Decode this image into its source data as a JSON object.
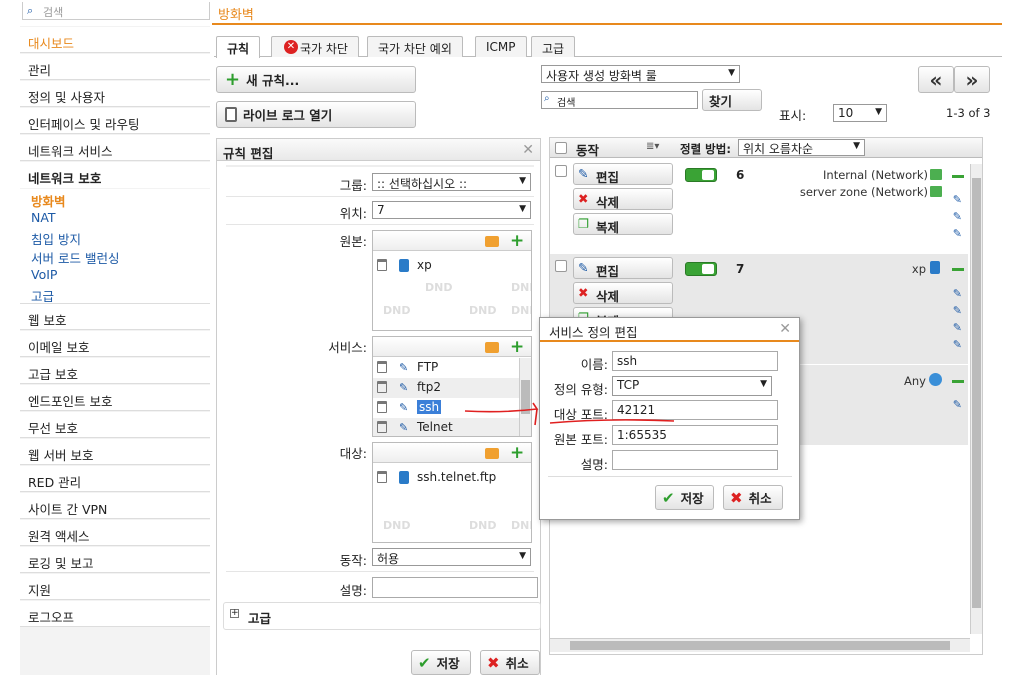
{
  "top": {
    "search_placeholder": "검색",
    "breadcrumb": "방화벽"
  },
  "sidebar": {
    "items": [
      {
        "label": "대시보드"
      },
      {
        "label": "관리"
      },
      {
        "label": "정의 및 사용자"
      },
      {
        "label": "인터페이스 및 라우팅"
      },
      {
        "label": "네트워크 서비스"
      },
      {
        "label": "네트워크 보호"
      },
      {
        "label": "방화벽"
      },
      {
        "label": "NAT"
      },
      {
        "label": "침입 방지"
      },
      {
        "label": "서버 로드 밸런싱"
      },
      {
        "label": "VoIP"
      },
      {
        "label": "고급"
      },
      {
        "label": "웹 보호"
      },
      {
        "label": "이메일 보호"
      },
      {
        "label": "고급 보호"
      },
      {
        "label": "엔드포인트 보호"
      },
      {
        "label": "무선 보호"
      },
      {
        "label": "웹 서버 보호"
      },
      {
        "label": "RED 관리"
      },
      {
        "label": "사이트 간 VPN"
      },
      {
        "label": "원격 액세스"
      },
      {
        "label": "로깅 및 보고"
      },
      {
        "label": "지원"
      },
      {
        "label": "로그오프"
      }
    ]
  },
  "tabs": [
    {
      "label": "규칙"
    },
    {
      "label": "국가 차단"
    },
    {
      "label": "국가 차단 예외"
    },
    {
      "label": "ICMP"
    },
    {
      "label": "고급"
    }
  ],
  "toolbar": {
    "new_rule": "새 규칙...",
    "open_live_log": "라이브 로그 열기",
    "ruleset_select": "사용자 생성 방화벽 룰",
    "search_value": "검색",
    "find": "찾기",
    "display_label": "표시:",
    "display_value": "10",
    "range": "1-3 of 3",
    "prev": "«",
    "next": "»"
  },
  "rule_edit": {
    "title": "규칙 편집",
    "group_label": "그룹:",
    "group_value": ":: 선택하십시오 ::",
    "position_label": "위치:",
    "position_value": "7",
    "source_label": "원본:",
    "source_items": [
      "xp"
    ],
    "service_label": "서비스:",
    "service_items": [
      "FTP",
      "ftp2",
      "ssh",
      "Telnet"
    ],
    "dest_label": "대상:",
    "dest_items": [
      "ssh.telnet.ftp"
    ],
    "action_label": "동작:",
    "action_value": "허용",
    "comment_label": "설명:",
    "advanced": "고급",
    "dnd": "DND",
    "save": "저장",
    "cancel": "취소"
  },
  "rules_list": {
    "col_action": "동작",
    "sort_label": "정렬 방법:",
    "sort_value": "위치 오름차순",
    "edit": "편집",
    "delete": "삭제",
    "copy": "복제",
    "rows": [
      {
        "num": "6",
        "sources": [
          "Internal (Network)",
          "server zone (Network)"
        ]
      },
      {
        "num": "7",
        "sources": [
          "xp"
        ]
      },
      {
        "num": "",
        "sources": [
          "Any"
        ]
      }
    ]
  },
  "modal": {
    "title": "서비스 정의 편집",
    "name_label": "이름:",
    "name_value": "ssh",
    "type_label": "정의 유형:",
    "type_value": "TCP",
    "dest_port_label": "대상 포트:",
    "dest_port_value": "42121",
    "src_port_label": "원본 포트:",
    "src_port_value": "1:65535",
    "desc_label": "설명:",
    "save": "저장",
    "cancel": "취소"
  },
  "colors": {
    "accent": "#e8891d",
    "link": "#1d5aa6",
    "green": "#3aa335",
    "red_annot": "#e02020"
  }
}
